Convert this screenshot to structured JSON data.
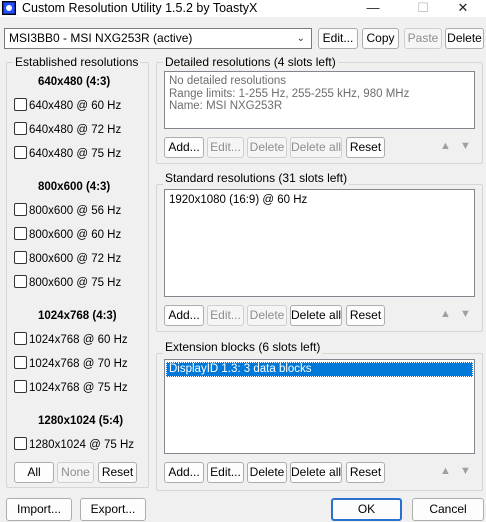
{
  "window": {
    "title": "Custom Resolution Utility 1.5.2 by ToastyX",
    "minimize_glyph": "—",
    "maximize_glyph": "☐",
    "close_glyph": "✕"
  },
  "display_select": {
    "value": "MSI3BB0 - MSI NXG253R (active)",
    "arrow": "⌄"
  },
  "top_buttons": {
    "edit": "Edit...",
    "copy": "Copy",
    "paste": "Paste",
    "delete": "Delete"
  },
  "established": {
    "label": "Established resolutions",
    "sections": [
      {
        "title": "640x480 (4:3)",
        "items": [
          "640x480 @ 60 Hz",
          "640x480 @ 72 Hz",
          "640x480 @ 75 Hz"
        ]
      },
      {
        "title": "800x600 (4:3)",
        "items": [
          "800x600 @ 56 Hz",
          "800x600 @ 60 Hz",
          "800x600 @ 72 Hz",
          "800x600 @ 75 Hz"
        ]
      },
      {
        "title": "1024x768 (4:3)",
        "items": [
          "1024x768 @ 60 Hz",
          "1024x768 @ 70 Hz",
          "1024x768 @ 75 Hz"
        ]
      },
      {
        "title": "1280x1024 (5:4)",
        "items": [
          "1280x1024 @ 75 Hz"
        ]
      }
    ],
    "buttons": {
      "all": "All",
      "none": "None",
      "reset": "Reset"
    }
  },
  "detailed": {
    "label": "Detailed resolutions (4 slots left)",
    "lines": [
      "No detailed resolutions",
      "Range limits: 1-255 Hz, 255-255 kHz, 980 MHz",
      "Name: MSI NXG253R"
    ],
    "buttons": {
      "add": "Add...",
      "edit": "Edit...",
      "delete": "Delete",
      "delete_all": "Delete all",
      "reset": "Reset"
    }
  },
  "standard": {
    "label": "Standard resolutions (31 slots left)",
    "items": [
      "1920x1080 (16:9) @ 60 Hz"
    ],
    "buttons": {
      "add": "Add...",
      "edit": "Edit...",
      "delete": "Delete",
      "delete_all": "Delete all",
      "reset": "Reset"
    }
  },
  "extension": {
    "label": "Extension blocks (6 slots left)",
    "items": [
      "DisplayID 1.3: 3 data blocks"
    ],
    "buttons": {
      "add": "Add...",
      "edit": "Edit...",
      "delete": "Delete",
      "delete_all": "Delete all",
      "reset": "Reset"
    }
  },
  "arrows": {
    "up": "▲",
    "down": "▼"
  },
  "bottom": {
    "import": "Import...",
    "export": "Export...",
    "ok": "OK",
    "cancel": "Cancel"
  }
}
